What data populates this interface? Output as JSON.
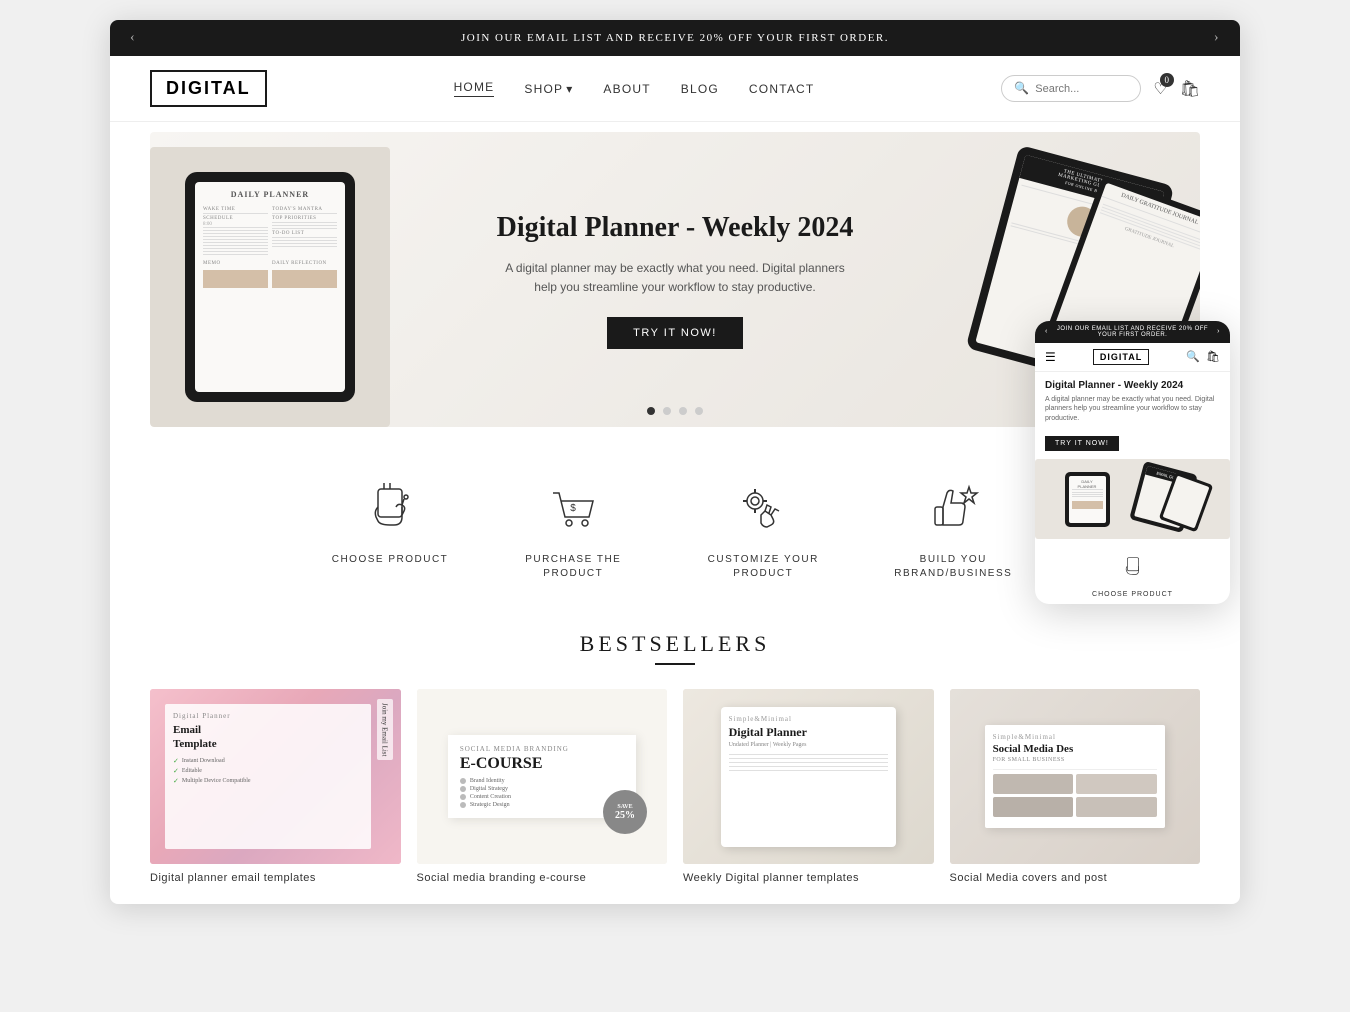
{
  "announcement": {
    "text": "JOIN OUR EMAIL LIST AND RECEIVE 20% OFF YOUR FIRST ORDER.",
    "prev_label": "‹",
    "next_label": "›"
  },
  "header": {
    "logo": "DIGITAL",
    "nav": [
      {
        "label": "HOME",
        "active": true
      },
      {
        "label": "SHOP",
        "has_dropdown": true
      },
      {
        "label": "ABOUT"
      },
      {
        "label": "BLOG"
      },
      {
        "label": "CONTACT"
      }
    ],
    "search_placeholder": "Search...",
    "wishlist_count": "0",
    "cart_label": "cart"
  },
  "hero": {
    "title": "Digital Planner - Weekly 2024",
    "description": "A digital planner may be exactly what you need. Digital planners help you streamline your workflow to stay productive.",
    "cta_label": "TRY IT NOW!",
    "dots": [
      {
        "active": true
      },
      {
        "active": false
      },
      {
        "active": false
      },
      {
        "active": false
      }
    ]
  },
  "steps": [
    {
      "label": "CHOOSE PRODUCT",
      "icon": "hand-pointer"
    },
    {
      "label": "PURCHASE THE PRODUCT",
      "icon": "shopping-cart-dollar"
    },
    {
      "label": "CUSTOMIZE YOUR PRODUCT",
      "icon": "gear-hand"
    },
    {
      "label": "BUILD YOU RBRAND/BUSINESS",
      "icon": "thumbs-up-star"
    }
  ],
  "bestsellers": {
    "title": "BESTSELLERS",
    "products": [
      {
        "name": "Digital planner email templates",
        "has_sale": true,
        "mock_type": "email-template"
      },
      {
        "name": "Social media branding e-course",
        "has_sale": false,
        "mock_type": "ecourse"
      },
      {
        "name": "Weekly Digital planner templates",
        "has_sale": true,
        "mock_type": "planner"
      },
      {
        "name": "Social Media covers and post",
        "has_sale": false,
        "mock_type": "social-media"
      }
    ]
  },
  "mobile_preview": {
    "announcement": "JOIN OUR EMAIL LIST AND RECEIVE 20% OFF YOUR FIRST ORDER.",
    "logo": "DIGITAL",
    "hero_title": "Digital Planner - Weekly 2024",
    "hero_desc": "A digital planner may be exactly what you need. Digital planners help you streamline your workflow to stay productive.",
    "cta_label": "TRY IT NOW!",
    "step_label": "CHOOSE PRODUCT"
  }
}
